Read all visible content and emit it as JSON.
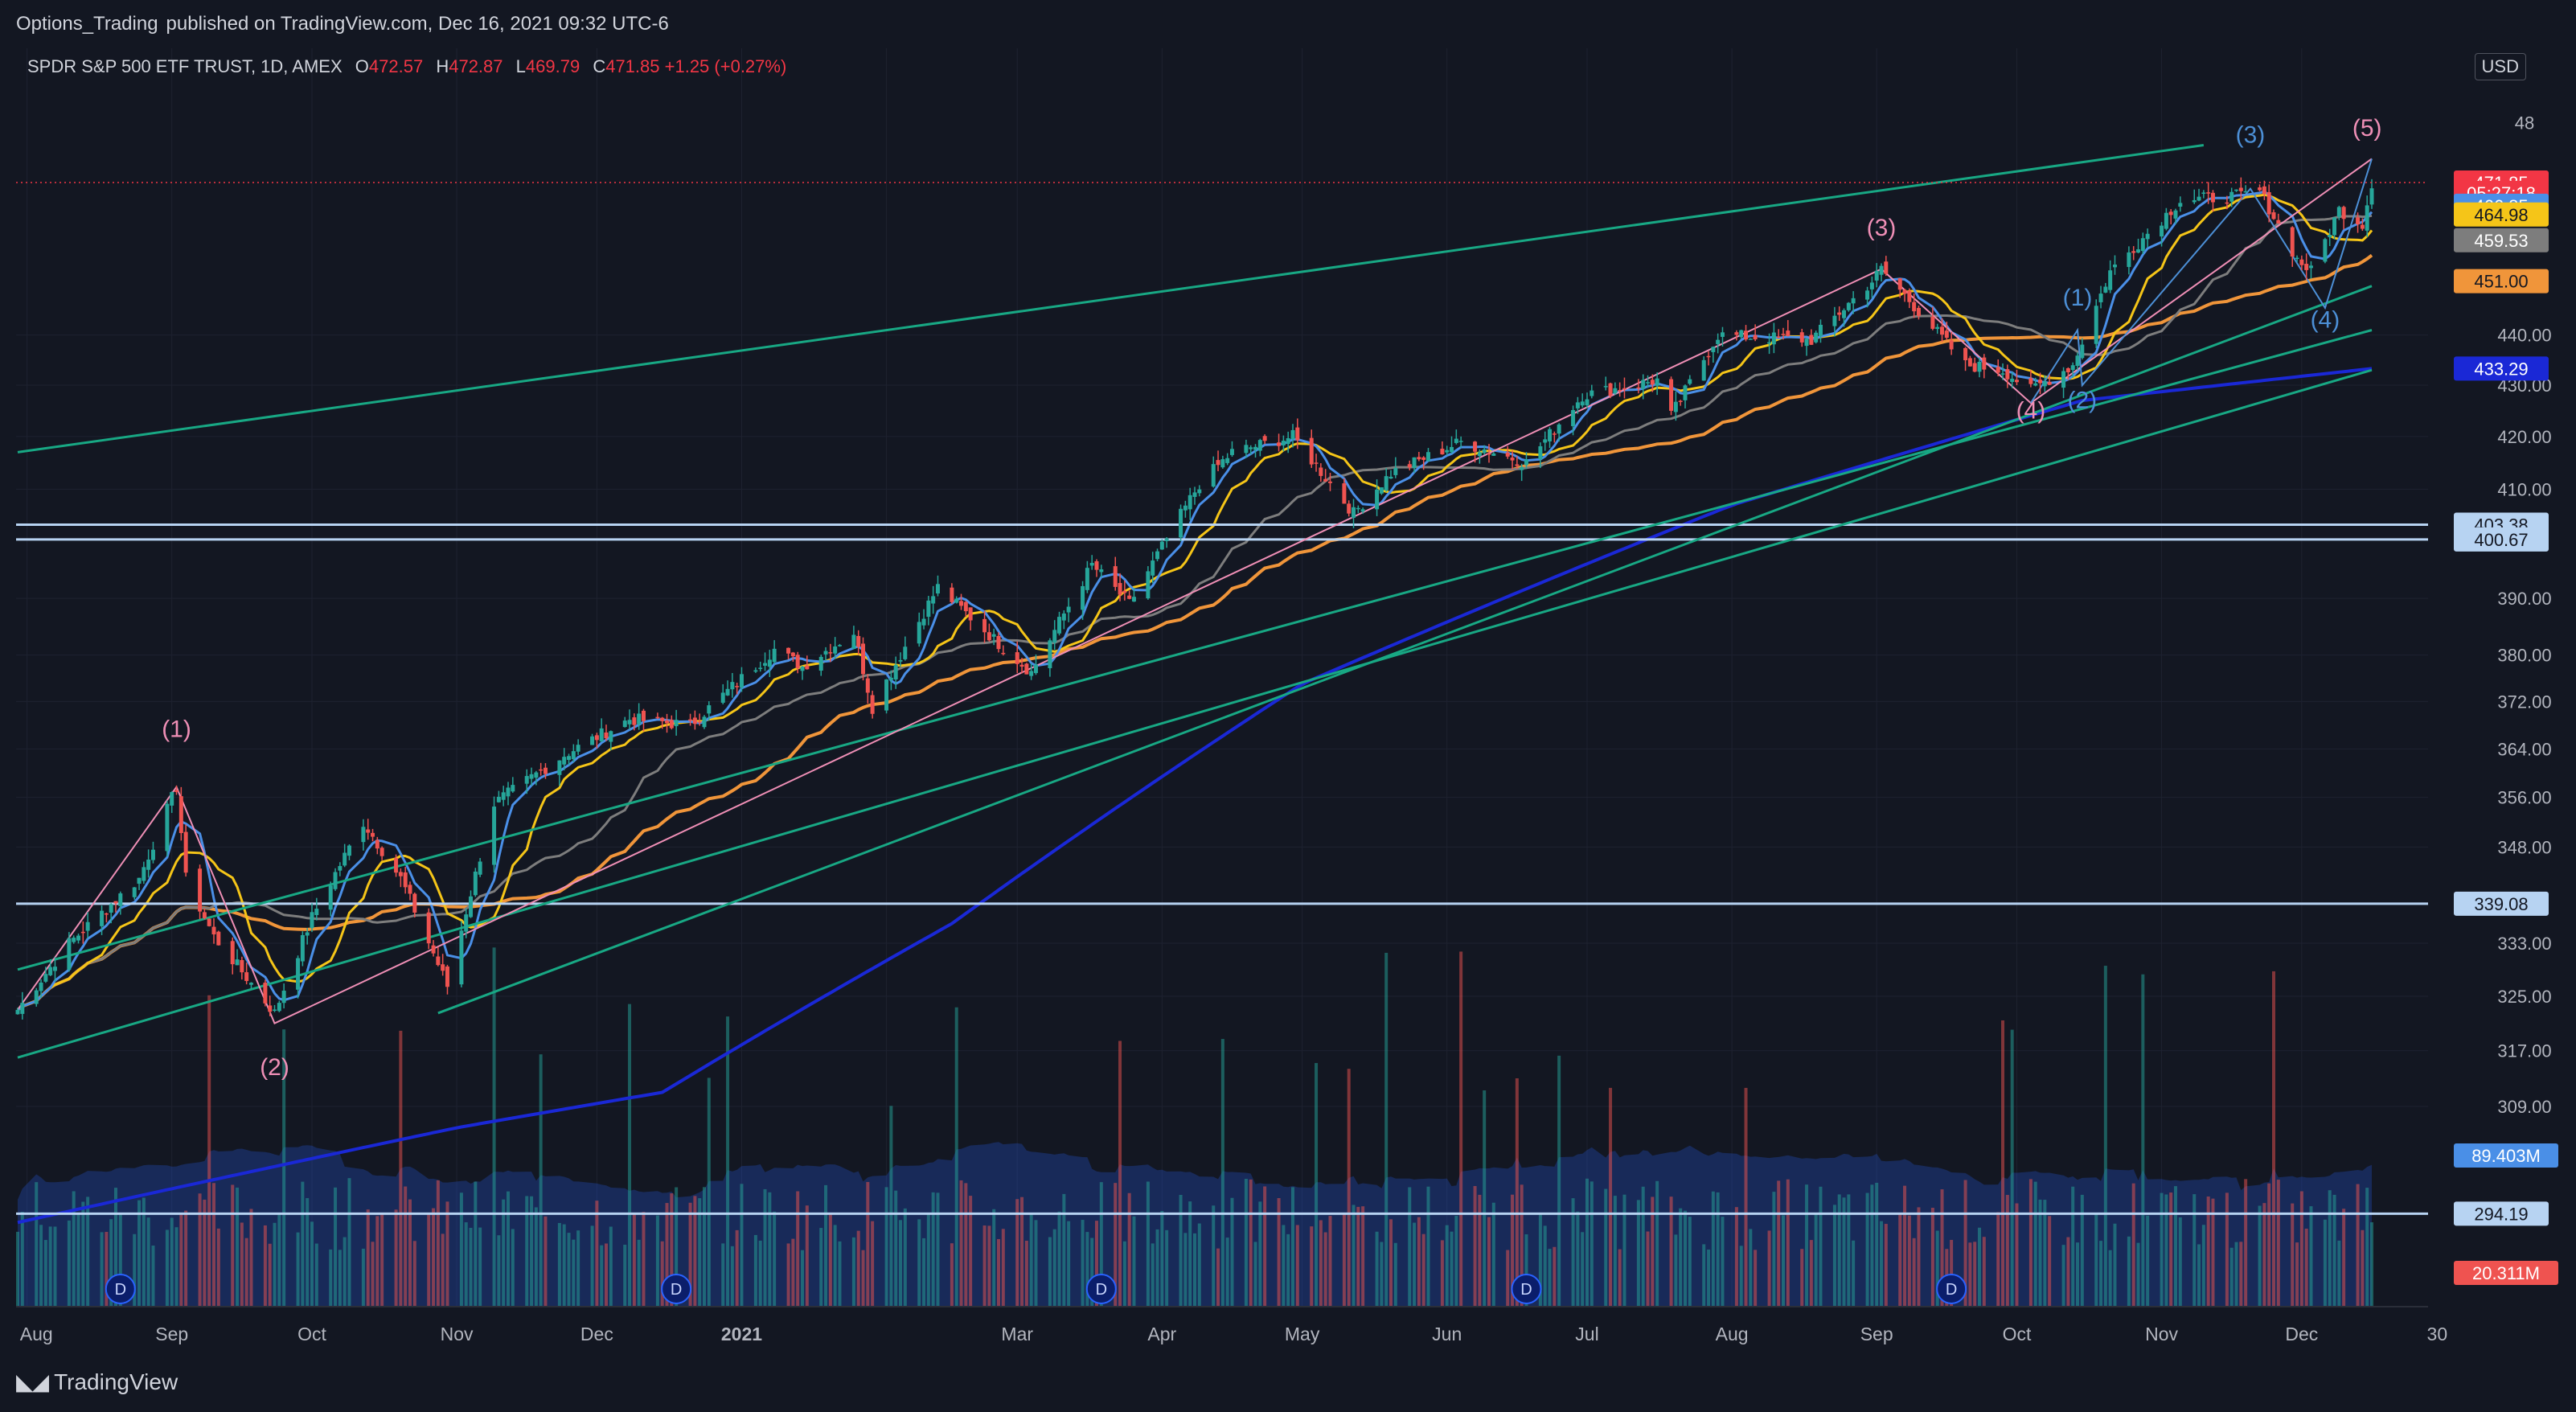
{
  "publisher": {
    "author": "Options_Trading",
    "text": "published on TradingView.com, Dec 16, 2021 09:32 UTC-6"
  },
  "symbol": {
    "name": "SPDR S&P 500 ETF TRUST, 1D, AMEX",
    "o_label": "O",
    "o": "472.57",
    "h_label": "H",
    "h": "472.87",
    "l_label": "L",
    "l": "469.79",
    "c_label": "C",
    "c": "471.85",
    "change": "+1.25 (+0.27%)"
  },
  "currency_button": "USD",
  "footer_logo": "TradingView",
  "colors": {
    "background": "#131722",
    "up": "#26a69a",
    "down": "#ef5350",
    "ma_blue": "#4a8fe7",
    "ma_yellow": "#f5c518",
    "ma_gray": "#7d7d7d",
    "ma_orange": "#f0953a",
    "ma_navy": "#1a28d6",
    "channel": "#18a884",
    "hline": "#b7d3f2",
    "wave_pink": "#ef8fb6",
    "wave_blue": "#4c8fd6"
  },
  "chart_data": {
    "type": "candlestick",
    "x_axis_labels": [
      "Aug",
      "Sep",
      "Oct",
      "Nov",
      "Dec",
      "2021",
      "Mar",
      "Apr",
      "May",
      "Jun",
      "Jul",
      "Aug",
      "Sep",
      "Oct",
      "Nov",
      "Dec",
      "30"
    ],
    "y_axis_ticks": [
      "48",
      "440.00",
      "430.00",
      "420.00",
      "410.00",
      "390.00",
      "380.00",
      "372.00",
      "364.00",
      "356.00",
      "348.00",
      "333.00",
      "325.00",
      "317.00",
      "309.00"
    ],
    "y_log_scale": true,
    "price_labels": [
      {
        "text": "471.85",
        "price": 471.85,
        "color": "#f23645"
      },
      {
        "text": "05:27:18",
        "price": 469.6,
        "color": "#f23645"
      },
      {
        "text": "466.85",
        "price": 466.85,
        "color": "#4a8fe7"
      },
      {
        "text": "464.98",
        "price": 464.98,
        "color": "#f5c518"
      },
      {
        "text": "459.53",
        "price": 459.53,
        "color": "#7d7d7d"
      },
      {
        "text": "451.00",
        "price": 451.0,
        "color": "#f0953a"
      },
      {
        "text": "433.29",
        "price": 433.29,
        "color": "#1a28d6"
      },
      {
        "text": "403.38",
        "price": 403.38,
        "color": "#b7d3f2"
      },
      {
        "text": "400.67",
        "price": 400.67,
        "color": "#b7d3f2"
      },
      {
        "text": "339.08",
        "price": 339.08,
        "color": "#b7d3f2"
      },
      {
        "text": "294.19",
        "price": 294.19,
        "color": "#b7d3f2"
      }
    ],
    "volume_labels": [
      {
        "text": "89.403M",
        "color": "#4a8fe7"
      },
      {
        "text": "20.311M",
        "color": "#ef5350"
      }
    ],
    "close_series_anchors": [
      [
        "2020-07-30",
        323
      ],
      [
        "2020-08-10",
        333
      ],
      [
        "2020-08-25",
        343
      ],
      [
        "2020-09-02",
        357.7
      ],
      [
        "2020-09-04",
        343
      ],
      [
        "2020-09-10",
        334
      ],
      [
        "2020-09-23",
        322.5
      ],
      [
        "2020-10-01",
        337
      ],
      [
        "2020-10-12",
        352
      ],
      [
        "2020-10-20",
        343
      ],
      [
        "2020-10-30",
        326.5
      ],
      [
        "2020-11-09",
        355
      ],
      [
        "2020-11-24",
        363
      ],
      [
        "2020-12-08",
        369
      ],
      [
        "2020-12-21",
        368
      ],
      [
        "2021-01-08",
        381
      ],
      [
        "2021-01-14",
        378
      ],
      [
        "2021-01-25",
        384
      ],
      [
        "2021-01-29",
        371
      ],
      [
        "2021-02-12",
        392
      ],
      [
        "2021-02-25",
        382
      ],
      [
        "2021-03-04",
        377
      ],
      [
        "2021-03-17",
        396
      ],
      [
        "2021-03-25",
        389
      ],
      [
        "2021-04-09",
        411
      ],
      [
        "2021-04-16",
        417
      ],
      [
        "2021-04-29",
        420
      ],
      [
        "2021-05-12",
        405.5
      ],
      [
        "2021-05-20",
        413
      ],
      [
        "2021-06-04",
        419
      ],
      [
        "2021-06-18",
        415
      ],
      [
        "2021-06-30",
        428
      ],
      [
        "2021-07-16",
        431
      ],
      [
        "2021-07-19",
        424
      ],
      [
        "2021-07-29",
        440
      ],
      [
        "2021-08-18",
        439
      ],
      [
        "2021-08-31",
        451
      ],
      [
        "2021-09-02",
        453.5
      ],
      [
        "2021-09-20",
        434
      ],
      [
        "2021-09-28",
        433
      ],
      [
        "2021-10-04",
        429
      ],
      [
        "2021-10-13",
        434
      ],
      [
        "2021-10-21",
        453
      ],
      [
        "2021-11-05",
        468
      ],
      [
        "2021-11-18",
        469
      ],
      [
        "2021-11-22",
        470
      ],
      [
        "2021-11-30",
        455.5
      ],
      [
        "2021-12-03",
        453
      ],
      [
        "2021-12-09",
        466
      ],
      [
        "2021-12-14",
        463
      ],
      [
        "2021-12-16",
        471.85
      ]
    ],
    "horizontal_levels": [
      403.38,
      400.67,
      339.08,
      294.19
    ],
    "moving_averages": [
      {
        "color": "#4a8fe7",
        "last": 466.85
      },
      {
        "color": "#f5c518",
        "last": 464.98
      },
      {
        "color": "#7d7d7d",
        "last": 459.53
      },
      {
        "color": "#f0953a",
        "last": 451.0
      },
      {
        "color": "#1a28d6",
        "last": 433.29
      }
    ],
    "channels": [
      {
        "from": [
          "2020-07-30",
          329
        ],
        "to": [
          "2021-12-16",
          441
        ]
      },
      {
        "from": [
          "2020-07-30",
          316
        ],
        "to": [
          "2021-12-16",
          433
        ]
      },
      {
        "from": [
          "2020-10-28",
          322.5
        ],
        "to": [
          "2021-12-16",
          450
        ]
      },
      {
        "from": [
          "2020-07-30",
          417
        ],
        "to": [
          "2021-11-10",
          480
        ]
      }
    ],
    "wave_labels": [
      {
        "text": "(1)",
        "date": "2020-09-02",
        "price": 366,
        "color": "#ef8fb6"
      },
      {
        "text": "(2)",
        "date": "2020-09-23",
        "price": 313.5,
        "color": "#ef8fb6"
      },
      {
        "text": "(3)",
        "date": "2021-09-02",
        "price": 460.5,
        "color": "#ef8fb6"
      },
      {
        "text": "(4)",
        "date": "2021-10-04",
        "price": 423.5,
        "color": "#ef8fb6"
      },
      {
        "text": "(5)",
        "date": "2021-12-15",
        "price": 482,
        "color": "#ef8fb6"
      },
      {
        "text": "(1)",
        "date": "2021-10-14",
        "price": 446,
        "color": "#4c8fd6"
      },
      {
        "text": "(2)",
        "date": "2021-10-15",
        "price": 425.5,
        "color": "#4c8fd6"
      },
      {
        "text": "(3)",
        "date": "2021-11-20",
        "price": 480.5,
        "color": "#4c8fd6"
      },
      {
        "text": "(4)",
        "date": "2021-12-06",
        "price": 441.5,
        "color": "#4c8fd6"
      }
    ],
    "dividend_markers": [
      "D",
      "D",
      "D",
      "D",
      "D"
    ]
  }
}
